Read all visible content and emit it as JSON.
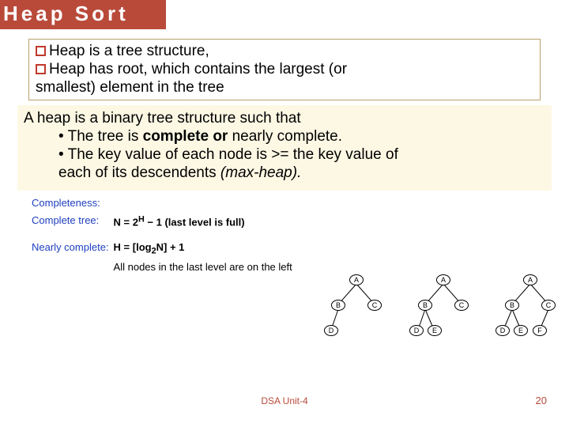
{
  "title": "Heap Sort",
  "box1": {
    "line1": "Heap is a tree structure,",
    "line2": "Heap has root, which contains the largest (or",
    "line3": "smallest) element in the tree"
  },
  "box2": {
    "intro": "A heap is a binary tree structure such that",
    "b1a": "• The tree is ",
    "b1b": "complete",
    "b1c": " or ",
    "b1d": "nearly complete.",
    "b2a": "• The key value of each node is >= the key value of",
    "b2b": "each of its descendents ",
    "b2c": "(max-heap)."
  },
  "defs": {
    "completeness": "Completeness:",
    "complete_label": "Complete tree:",
    "complete_formula_a": "N = 2",
    "complete_formula_sup": "H",
    "complete_formula_b": " − 1 (last level is full)",
    "nearly_label": "Nearly complete:",
    "nearly_formula_a": "H = [log",
    "nearly_formula_sub": "2",
    "nearly_formula_b": "N] + 1",
    "nearly_note": "All nodes in the last level are on the left"
  },
  "nodes": {
    "A": "A",
    "B": "B",
    "C": "C",
    "D": "D",
    "E": "E",
    "F": "F"
  },
  "footer": {
    "course": "DSA Unit-4",
    "page": "20"
  }
}
